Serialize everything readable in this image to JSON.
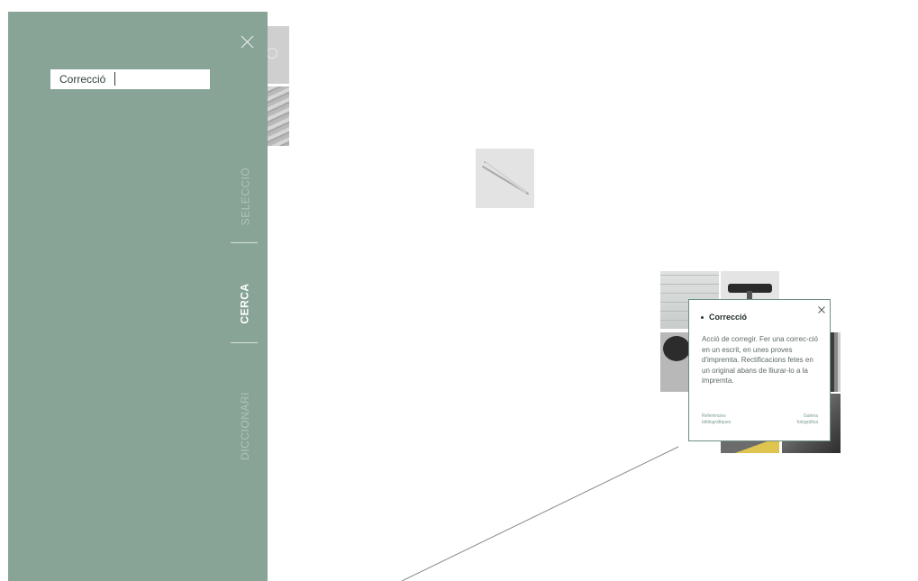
{
  "panel": {
    "search": {
      "value": "Correcció"
    },
    "tabs": [
      {
        "label": "SELECCIÓ",
        "active": false
      },
      {
        "label": "CERCA",
        "active": true
      },
      {
        "label": "DICCIONARI",
        "active": false
      }
    ],
    "close_icon": "close-icon"
  },
  "card": {
    "title": "Correcció",
    "definition": "Acció de corregir. Fer una correc-ció en un escrit, en unes proves d'impremta. Rectificacions fetes en un original abans de lliurar-lo a la impremta.",
    "links": {
      "references": "Referències bibliogràfiques",
      "gallery": "Galeria fotogràfica"
    },
    "close_icon": "close-icon"
  },
  "colors": {
    "panel_bg": "#88a497",
    "tab_active": "#ffffff",
    "tab_inactive": "#aec3b9",
    "card_border": "#6e8f81",
    "link": "#7a9c8e"
  }
}
